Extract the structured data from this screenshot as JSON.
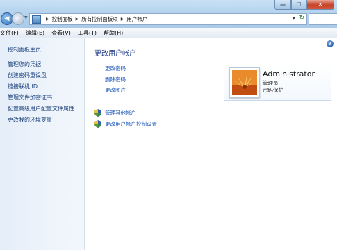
{
  "address_bar": {
    "breadcrumbs": [
      "控制面板",
      "所有控制面板项",
      "用户帐户"
    ]
  },
  "menu": {
    "items": [
      "文件(F)",
      "编辑(E)",
      "查看(V)",
      "工具(T)",
      "帮助(H)"
    ]
  },
  "sidebar": {
    "items": [
      {
        "label": "控制面板主页"
      },
      {
        "label": "管理您的凭据"
      },
      {
        "label": "创建密码重设盘"
      },
      {
        "label": "链接联机 ID"
      },
      {
        "label": "管理文件加密证书"
      },
      {
        "label": "配置高级用户配置文件属性"
      },
      {
        "label": "更改我的环境变量"
      }
    ]
  },
  "main": {
    "title": "更改用户帐户",
    "tasks": [
      "更改密码",
      "删除密码",
      "更改图片"
    ],
    "admin_tasks": [
      "管理其他帐户",
      "更改用户帐户控制设置"
    ]
  },
  "account": {
    "name": "Administrator",
    "role": "管理员",
    "status": "密码保护"
  },
  "icons": {
    "help": "help-icon",
    "shield": "uac-shield-icon",
    "folder": "control-panel-icon",
    "refresh": "refresh-icon"
  },
  "colors": {
    "link": "#1f58b8",
    "title": "#1e3a8a",
    "close_button": "#c7432a"
  }
}
